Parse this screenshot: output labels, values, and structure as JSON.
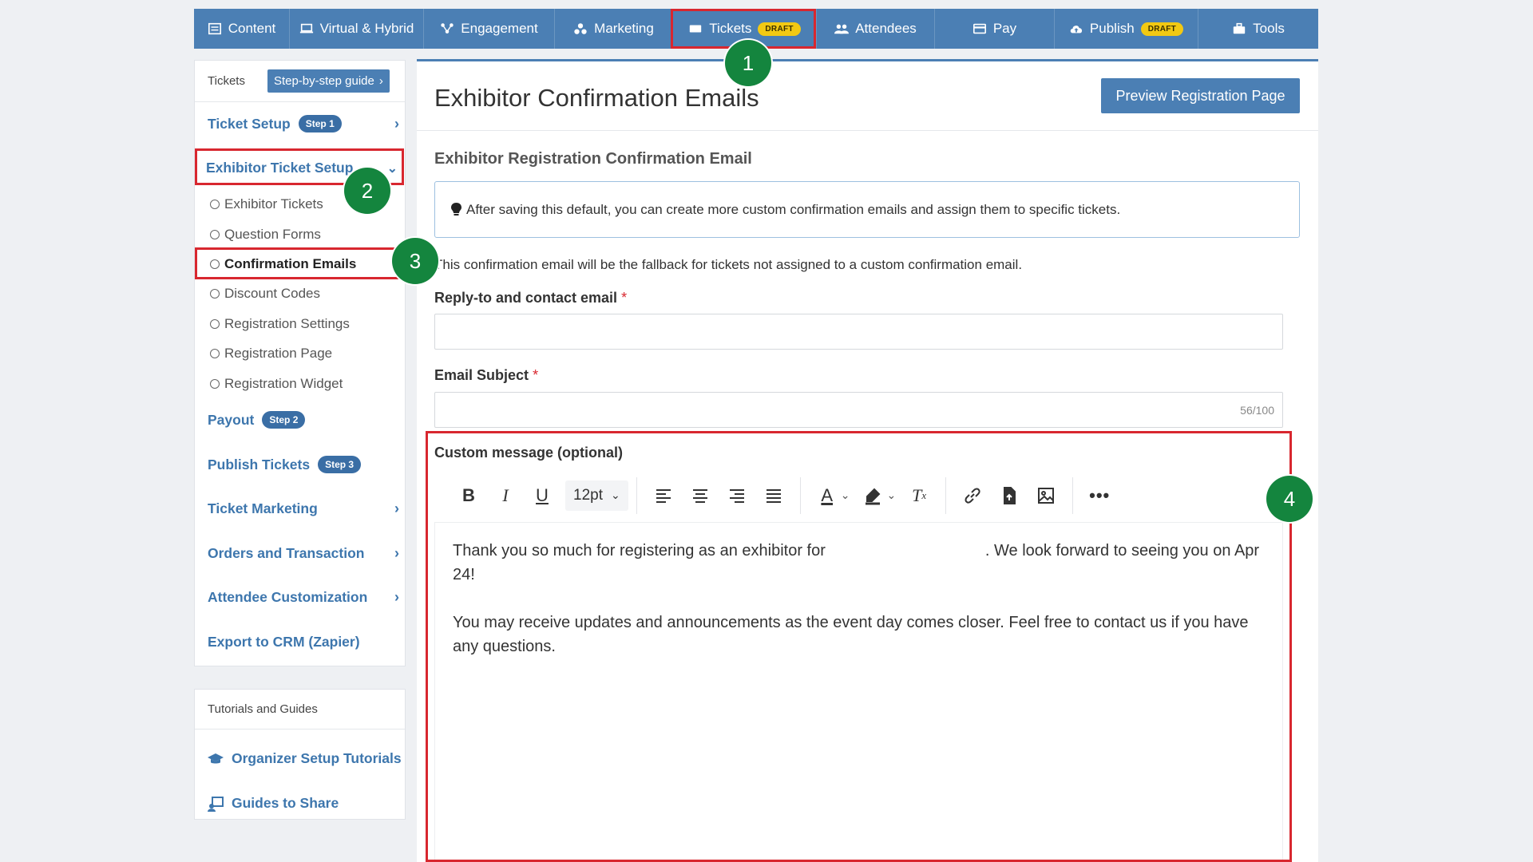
{
  "topnav": {
    "tabs": [
      {
        "label": "Content",
        "icon": "content-icon"
      },
      {
        "label": "Virtual & Hybrid",
        "icon": "monitor-icon"
      },
      {
        "label": "Engagement",
        "icon": "engagement-icon"
      },
      {
        "label": "Marketing",
        "icon": "marketing-icon"
      },
      {
        "label": "Tickets",
        "icon": "ticket-icon",
        "badge": "DRAFT"
      },
      {
        "label": "Attendees",
        "icon": "users-icon"
      },
      {
        "label": "Pay",
        "icon": "card-icon"
      },
      {
        "label": "Publish",
        "icon": "cloud-upload-icon",
        "badge": "DRAFT"
      },
      {
        "label": "Tools",
        "icon": "toolbox-icon"
      }
    ]
  },
  "annotations": [
    "1",
    "2",
    "3",
    "4"
  ],
  "sidebar": {
    "header": "Tickets",
    "guide_button": "Step-by-step guide",
    "ticket_setup": {
      "label": "Ticket Setup",
      "step": "Step 1"
    },
    "exhibitor_setup": {
      "label": "Exhibitor Ticket Setup"
    },
    "sub_items": [
      "Exhibitor Tickets",
      "Question Forms",
      "Confirmation Emails",
      "Discount Codes",
      "Registration Settings",
      "Registration Page",
      "Registration Widget"
    ],
    "payout": {
      "label": "Payout",
      "step": "Step 2"
    },
    "publish_tickets": {
      "label": "Publish Tickets",
      "step": "Step 3"
    },
    "ticket_marketing": "Ticket Marketing",
    "orders": "Orders and Transaction",
    "attendee_custom": "Attendee Customization",
    "export_crm": "Export to CRM (Zapier)"
  },
  "tutorials": {
    "header": "Tutorials and Guides",
    "items": [
      "Organizer Setup Tutorials",
      "Guides to Share"
    ]
  },
  "main": {
    "title": "Exhibitor Confirmation Emails",
    "preview_button": "Preview Registration Page",
    "section_title": "Exhibitor Registration Confirmation Email",
    "info_text": "After saving this default, you can create more custom confirmation emails and assign them to specific tickets.",
    "fallback_text": "This confirmation email will be the fallback for tickets not assigned to a custom confirmation email.",
    "reply_label": "Reply-to and contact email",
    "subject_label": "Email Subject",
    "subject_counter": "56/100",
    "custom_label": "Custom message (optional)",
    "font_size": "12pt",
    "message_p1_a": "Thank you so much for registering as an exhibitor for",
    "message_p1_b": ". We look forward to seeing you on Apr 24!",
    "message_p2": "You may receive updates and announcements as the event day comes closer. Feel free to contact us if you have any questions."
  },
  "colors": {
    "nav": "#4b7fb4",
    "highlight": "#d8272f",
    "annotation": "#14853e",
    "link": "#3d76ad",
    "badge": "#f2c913"
  }
}
